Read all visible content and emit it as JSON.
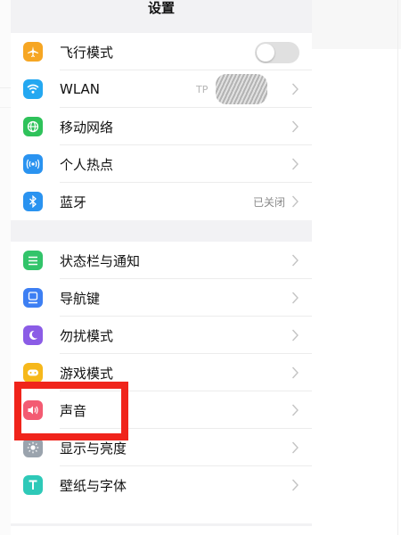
{
  "header": {
    "title": "设置"
  },
  "group1": {
    "items": [
      {
        "label": "飞行模式",
        "icon": "airplane-icon",
        "color": "#f6a623",
        "toggle": "off"
      },
      {
        "label": "WLAN",
        "icon": "wifi-icon",
        "color": "#24a8f1",
        "value": "TP"
      },
      {
        "label": "移动网络",
        "icon": "globe-icon",
        "color": "#2ec25a"
      },
      {
        "label": "个人热点",
        "icon": "hotspot-icon",
        "color": "#2a93f0"
      },
      {
        "label": "蓝牙",
        "icon": "bluetooth-icon",
        "color": "#2a93f0",
        "value": "已关闭"
      }
    ]
  },
  "group2": {
    "items": [
      {
        "label": "状态栏与通知",
        "icon": "notification-list-icon",
        "color": "#32c46a"
      },
      {
        "label": "导航键",
        "icon": "navigation-key-icon",
        "color": "#3d7ff3"
      },
      {
        "label": "勿扰模式",
        "icon": "moon-icon",
        "color": "#8b5ce6"
      },
      {
        "label": "游戏模式",
        "icon": "gamepad-icon",
        "color": "#f6b81b"
      },
      {
        "label": "声音",
        "icon": "speaker-icon",
        "color": "#f35b72"
      },
      {
        "label": "显示与亮度",
        "icon": "brightness-icon",
        "color": "#9aa3ad"
      },
      {
        "label": "壁纸与字体",
        "icon": "text-t-icon",
        "color": "#2ec9b8"
      }
    ]
  },
  "annotation": {
    "highlight_color": "#f0241b",
    "highlighted_item": "声音"
  }
}
